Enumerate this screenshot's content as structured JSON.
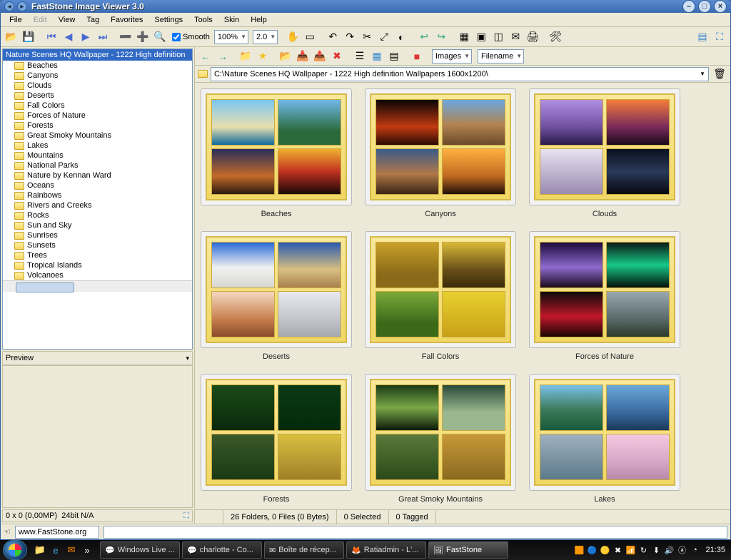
{
  "window": {
    "title": "FastStone Image Viewer 3.0"
  },
  "menu": {
    "items": [
      "File",
      "Edit",
      "View",
      "Tag",
      "Favorites",
      "Settings",
      "Tools",
      "Skin",
      "Help"
    ],
    "disabled_index": 1
  },
  "toolbar": {
    "smooth_label": "Smooth",
    "zoom_value": "100%",
    "ratio_value": "2.0"
  },
  "tree": {
    "header": "Nature Scenes HQ Wallpaper - 1222 High definition",
    "items": [
      "Beaches",
      "Canyons",
      "Clouds",
      "Deserts",
      "Fall Colors",
      "Forces of Nature",
      "Forests",
      "Great Smoky Mountains",
      "Lakes",
      "Mountains",
      "National Parks",
      "Nature by Kennan Ward",
      "Oceans",
      "Rainbows",
      "Rivers and Creeks",
      "Rocks",
      "Sun and Sky",
      "Sunrises",
      "Sunsets",
      "Trees",
      "Tropical Islands",
      "Volcanoes"
    ]
  },
  "preview": {
    "title": "Preview"
  },
  "left_status": {
    "dims": "0 x 0 (0,00MP)",
    "depth": "24bit N/A"
  },
  "browser_toolbar": {
    "view_combo": "Images",
    "sort_combo": "Filename"
  },
  "address": {
    "path": "C:\\Nature Scenes HQ Wallpaper - 1222 High definition Wallpapers 1600x1200\\"
  },
  "thumbnails": [
    {
      "label": "Beaches",
      "imgs": [
        "g-beach1",
        "g-beach2",
        "g-beach3",
        "g-beach4"
      ]
    },
    {
      "label": "Canyons",
      "imgs": [
        "g-can1",
        "g-can2",
        "g-can3",
        "g-can4"
      ]
    },
    {
      "label": "Clouds",
      "imgs": [
        "g-cld1",
        "g-cld2",
        "g-cld3",
        "g-cld4"
      ]
    },
    {
      "label": "Deserts",
      "imgs": [
        "g-des1",
        "g-des2",
        "g-des3",
        "g-des4"
      ]
    },
    {
      "label": "Fall Colors",
      "imgs": [
        "g-fc1",
        "g-fc2",
        "g-fc3",
        "g-fc4"
      ]
    },
    {
      "label": "Forces of Nature",
      "imgs": [
        "g-fn1",
        "g-fn2",
        "g-fn3",
        "g-fn4"
      ]
    },
    {
      "label": "Forests",
      "imgs": [
        "g-for1",
        "g-for2",
        "g-for3",
        "g-for4"
      ]
    },
    {
      "label": "Great Smoky Mountains",
      "imgs": [
        "g-gs1",
        "g-gs2",
        "g-gs3",
        "g-gs4"
      ]
    },
    {
      "label": "Lakes",
      "imgs": [
        "g-lk1",
        "g-lk2",
        "g-lk3",
        "g-lk4"
      ]
    }
  ],
  "right_status": {
    "folders": "26 Folders, 0 Files (0 Bytes)",
    "selected": "0 Selected",
    "tagged": "0 Tagged"
  },
  "linkbar": {
    "url": "www.FastStone.org"
  },
  "taskbar": {
    "buttons": [
      {
        "icon": "💬",
        "label": "Windows Live ..."
      },
      {
        "icon": "💬",
        "label": "charlotte - Co..."
      },
      {
        "icon": "✉",
        "label": "Boîte de récep..."
      },
      {
        "icon": "🦊",
        "label": "Ratiadmin - L'..."
      },
      {
        "icon": "🖼",
        "label": "FastStone"
      }
    ],
    "active_index": 4,
    "clock": "21:35"
  }
}
